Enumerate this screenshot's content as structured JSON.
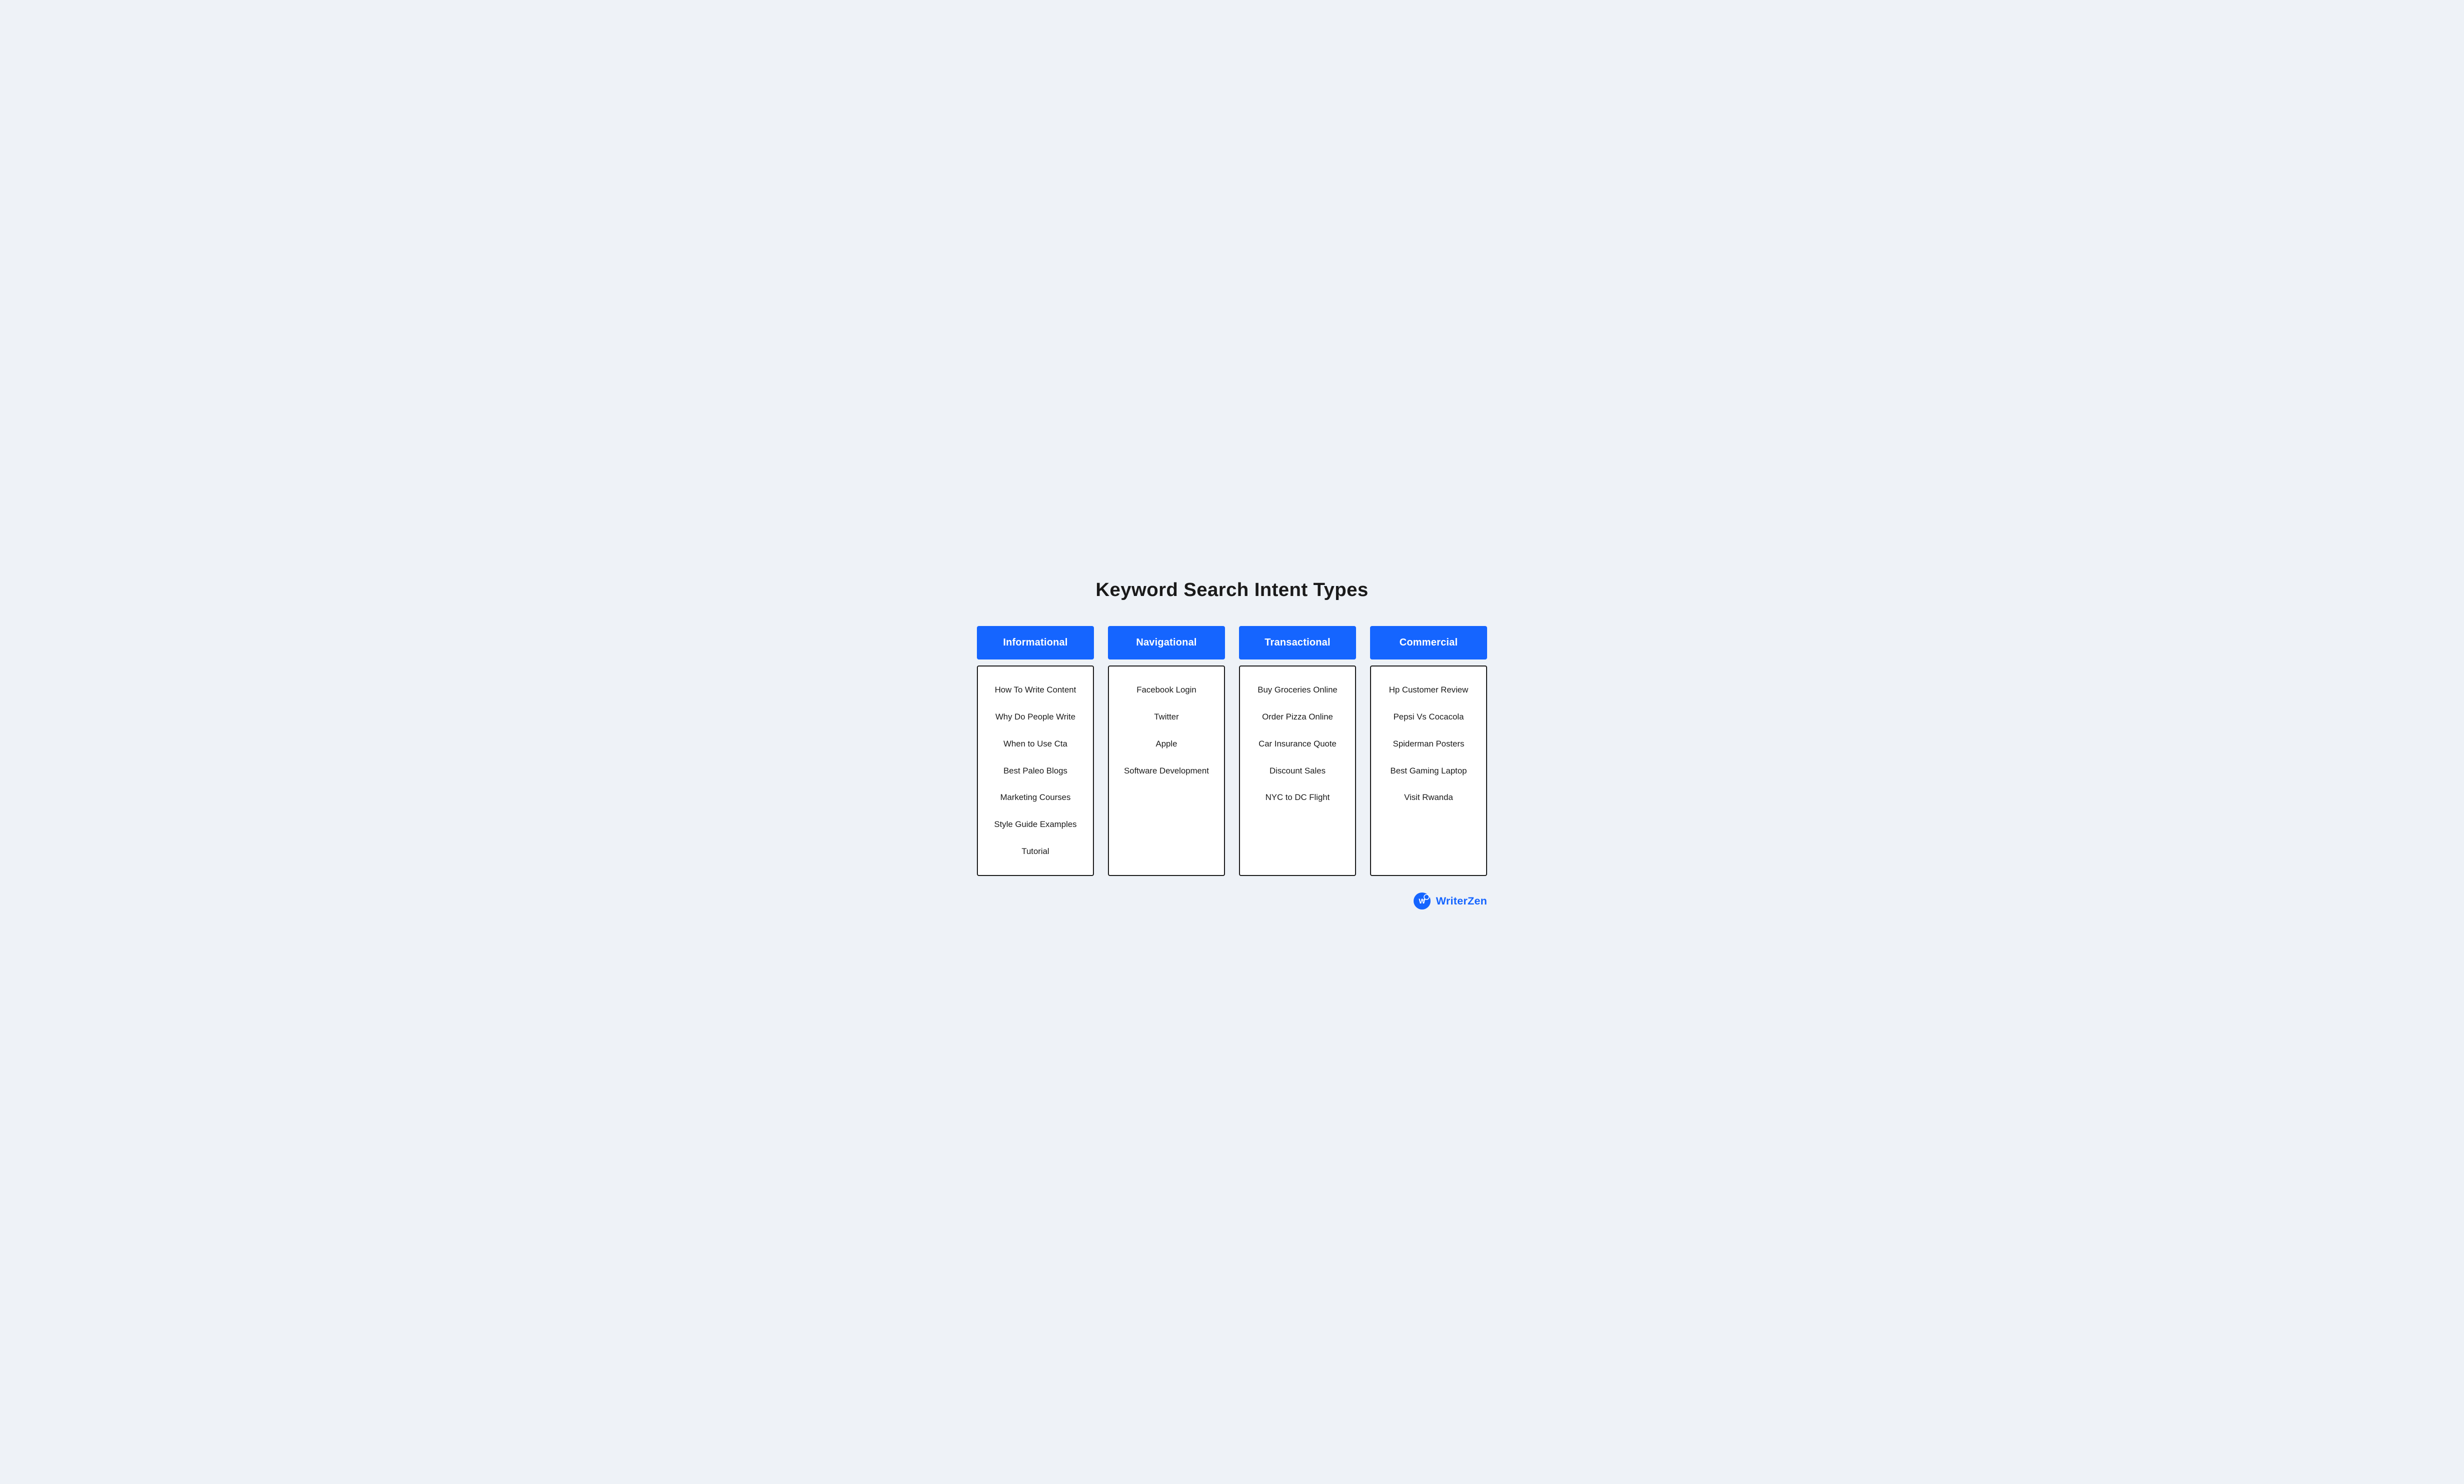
{
  "page": {
    "title": "Keyword Search Intent Types",
    "background_color": "#eef2f7"
  },
  "columns": [
    {
      "id": "informational",
      "header": "Informational",
      "items": [
        "How To Write Content",
        "Why Do People Write",
        "When to Use Cta",
        "Best Paleo Blogs",
        "Marketing Courses",
        "Style Guide Examples",
        "Tutorial"
      ]
    },
    {
      "id": "navigational",
      "header": "Navigational",
      "items": [
        "Facebook Login",
        "Twitter",
        "Apple",
        "Software Development"
      ]
    },
    {
      "id": "transactional",
      "header": "Transactional",
      "items": [
        "Buy Groceries Online",
        "Order Pizza Online",
        "Car Insurance Quote",
        "Discount Sales",
        "NYC to DC Flight"
      ]
    },
    {
      "id": "commercial",
      "header": "Commercial",
      "items": [
        "Hp Customer Review",
        "Pepsi Vs Cocacola",
        "Spiderman Posters",
        "Best Gaming Laptop",
        "Visit Rwanda"
      ]
    }
  ],
  "branding": {
    "name_part1": "Writer",
    "name_part2": "Zen"
  }
}
